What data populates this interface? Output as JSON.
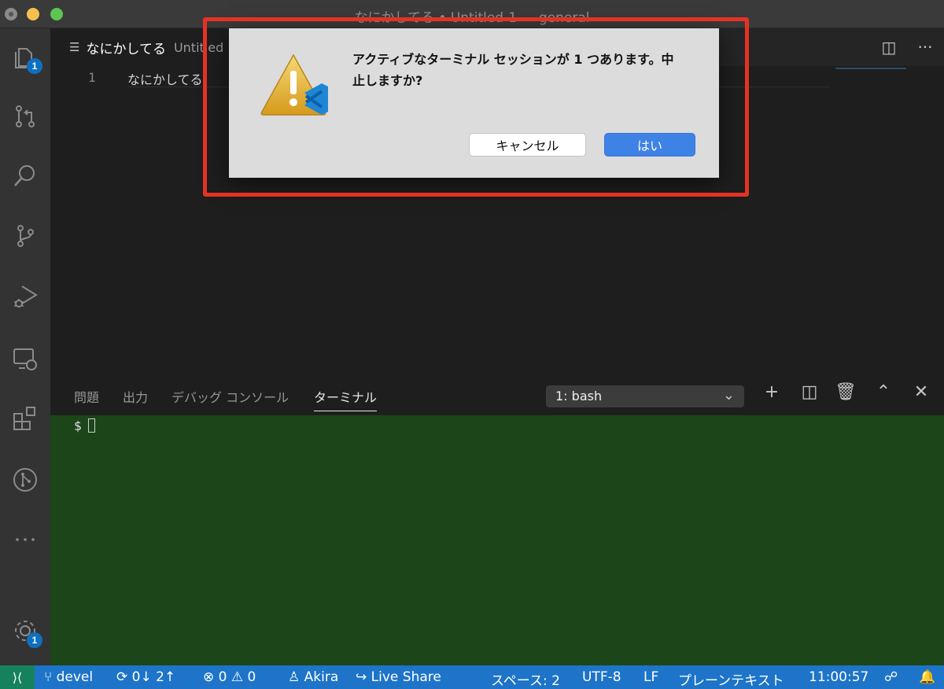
{
  "window": {
    "title": "なにかしてる • Untitled-1 — general"
  },
  "activity_bar": {
    "explorer_badge": "1",
    "settings_badge": "1"
  },
  "editor": {
    "tab_name": "なにかしてる",
    "tab_description": "Untitled",
    "line_number": "1",
    "line_text": "なにかしてる"
  },
  "panel": {
    "tabs": [
      "問題",
      "出力",
      "デバッグ コンソール",
      "ターミナル"
    ],
    "active_tab": "ターミナル",
    "terminal_select": "1: bash",
    "prompt": "$"
  },
  "dialog": {
    "message": "アクティブなターミナル セッションが 1 つあります。中止しますか?",
    "cancel_label": "キャンセル",
    "ok_label": "はい"
  },
  "status_bar": {
    "branch": "devel",
    "sync": "0↓ 2↑",
    "errors": "0",
    "warnings": "0",
    "user": "Akira",
    "live_share": "Live Share",
    "spaces": "スペース: 2",
    "encoding": "UTF-8",
    "eol": "LF",
    "language": "プレーンテキスト",
    "time": "11:00:57"
  },
  "colors": {
    "status_bar": "#1d74c8",
    "terminal_bg": "#1c4619",
    "primary_button": "#3f82e6",
    "highlight_border": "#e53223"
  }
}
